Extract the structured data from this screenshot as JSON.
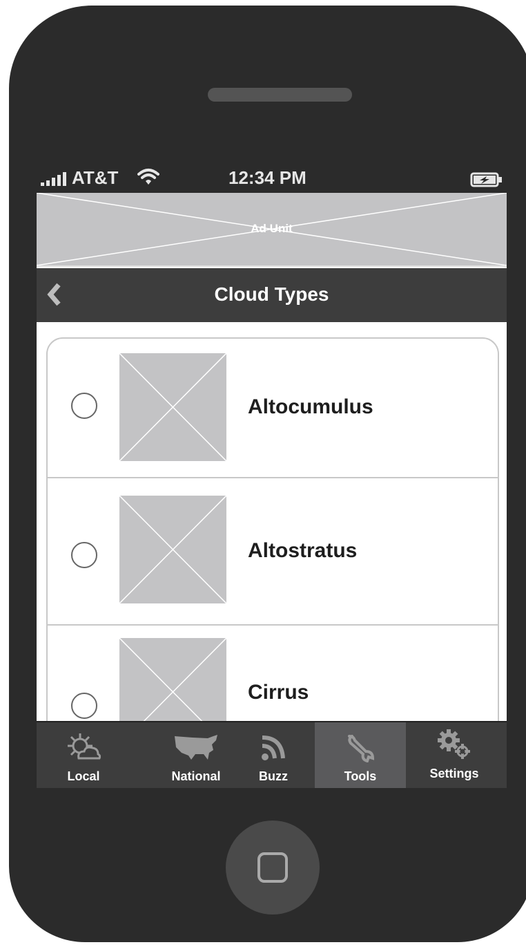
{
  "status": {
    "carrier": "AT&T",
    "time": "12:34 PM",
    "icons": [
      "signal-icon",
      "wifi-icon",
      "battery-charging-icon"
    ]
  },
  "ad": {
    "label": "Ad Unit"
  },
  "nav": {
    "title": "Cloud Types",
    "back_icon": "chevron-left-icon"
  },
  "list": {
    "items": [
      {
        "label": "Altocumulus",
        "selected": false
      },
      {
        "label": "Altostratus",
        "selected": false
      },
      {
        "label": "Cirrus",
        "selected": false
      }
    ]
  },
  "tabs": [
    {
      "label": "Local",
      "icon": "sun-cloud-icon",
      "active": false
    },
    {
      "label": "National",
      "icon": "usa-map-icon",
      "active": false
    },
    {
      "label": "Buzz",
      "icon": "rss-icon",
      "active": false
    },
    {
      "label": "Tools",
      "icon": "wrench-icon",
      "active": true
    },
    {
      "label": "Settings",
      "icon": "gears-icon",
      "active": false
    }
  ],
  "colors": {
    "device": "#2b2b2b",
    "navbar": "#3d3d3d",
    "tab_active": "#5a5a5c",
    "placeholder": "#c3c3c5"
  }
}
